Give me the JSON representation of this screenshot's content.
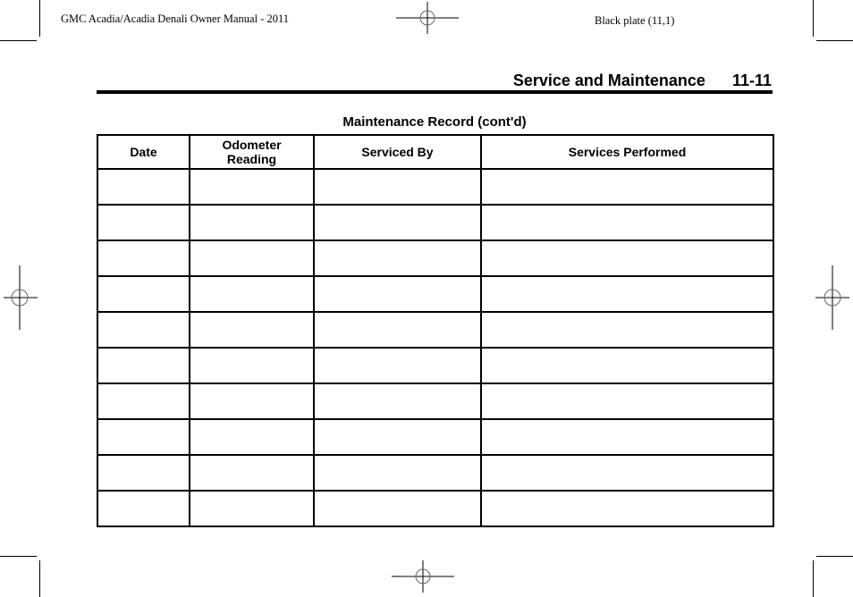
{
  "header": {
    "manual_title": "GMC Acadia/Acadia Denali Owner Manual - 2011",
    "plate": "Black plate (11,1)"
  },
  "section": {
    "title": "Service and Maintenance",
    "page_number": "11-11"
  },
  "table": {
    "title": "Maintenance Record (cont'd)",
    "columns": [
      "Date",
      "Odometer Reading",
      "Serviced By",
      "Services Performed"
    ],
    "rows": [
      [
        "",
        "",
        "",
        ""
      ],
      [
        "",
        "",
        "",
        ""
      ],
      [
        "",
        "",
        "",
        ""
      ],
      [
        "",
        "",
        "",
        ""
      ],
      [
        "",
        "",
        "",
        ""
      ],
      [
        "",
        "",
        "",
        ""
      ],
      [
        "",
        "",
        "",
        ""
      ],
      [
        "",
        "",
        "",
        ""
      ],
      [
        "",
        "",
        "",
        ""
      ],
      [
        "",
        "",
        "",
        ""
      ]
    ]
  },
  "icons": {
    "registration_marks": [
      "registration-mark-top",
      "registration-mark-left",
      "registration-mark-right",
      "registration-mark-bottom"
    ],
    "crop_marks": [
      "crop-mark-top-left",
      "crop-mark-top-right",
      "crop-mark-bottom-left",
      "crop-mark-bottom-right"
    ]
  }
}
